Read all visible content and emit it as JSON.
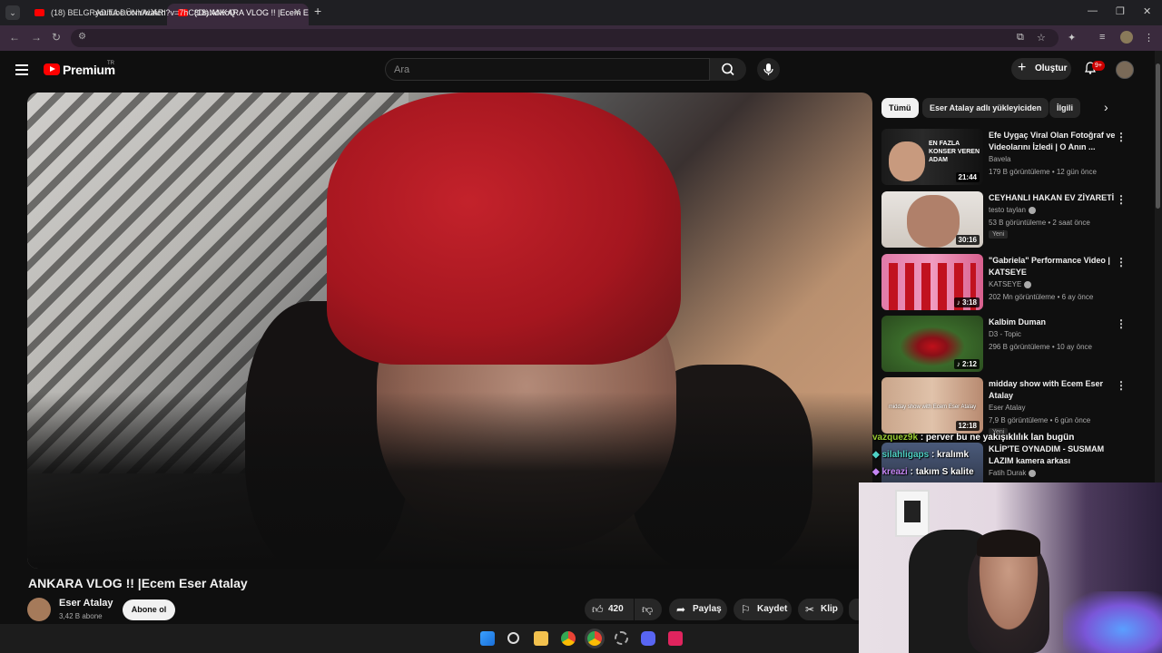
{
  "browser": {
    "tabs": [
      {
        "title": "(18) BELGRAD'TA DÜNYALARI Y",
        "active": false
      },
      {
        "title": "(18) ANKARA VLOG !! |Ecem Ese",
        "active": true
      }
    ],
    "url": "youtube.com/watch?v=7hC8DaNdKcQ"
  },
  "youtube": {
    "logo": "Premium",
    "region": "TR",
    "search_placeholder": "Ara",
    "create_label": "Oluştur",
    "notif_badge": "9+"
  },
  "video": {
    "title": "ANKARA VLOG !! |Ecem Eser Atalay",
    "channel": "Eser Atalay",
    "subscribers": "3,42 B abone",
    "subscribe_label": "Abone ol",
    "likes": "420",
    "share_label": "Paylaş",
    "save_label": "Kaydet",
    "clip_label": "Klip"
  },
  "chips": [
    "Tümü",
    "Eser Atalay adlı yükleyiciden",
    "İlgili"
  ],
  "recommendations": [
    {
      "title": "Efe Uygaç Viral Olan Fotoğraf ve Videolarını İzledi | O Anın ...",
      "channel": "Bavela",
      "meta": "179 B görüntüleme • 12 gün önce",
      "duration": "21:44",
      "badge": "",
      "thumb_text": "EN FAZLA KONSER VEREN ADAM"
    },
    {
      "title": "CEYHANLI HAKAN EV ZİYARETİ",
      "channel": "testo taylan",
      "meta": "53 B görüntüleme • 2 saat önce",
      "duration": "30:16",
      "badge": "Yeni",
      "thumb_text": ""
    },
    {
      "title": "\"Gabriela\" Performance Video | KATSEYE",
      "channel": "KATSEYE",
      "meta": "202 Mn görüntüleme • 6 ay önce",
      "duration": "3:18",
      "badge": "",
      "thumb_text": ""
    },
    {
      "title": "Kalbim Duman",
      "channel": "D3 - Topic",
      "meta": "296 B görüntüleme • 10 ay önce",
      "duration": "2:12",
      "badge": "",
      "thumb_text": ""
    },
    {
      "title": "midday show with Ecem Eser Atalay",
      "channel": "Eser Atalay",
      "meta": "7,9 B görüntüleme • 6 gün önce",
      "duration": "12:18",
      "badge": "Yeni",
      "thumb_text": "midday show with Ecem Eser Atalay"
    },
    {
      "title": "KLİP'TE OYNADIM - SUSMAM LAZIM kamera arkası",
      "channel": "Fatih Durak",
      "meta": "",
      "duration": "",
      "badge": "",
      "thumb_text": ""
    }
  ],
  "chat": [
    {
      "user": "vazquez9k",
      "message": ": perver bu ne yakışıklılık lan bugün"
    },
    {
      "user": "silahligaps",
      "message": ": kralımk"
    },
    {
      "user": "kreazi",
      "message": ": takım S kalite"
    }
  ],
  "colors": {
    "accent": "#ff0000",
    "bg": "#0f0f0f",
    "tab_active": "#3a2a3d"
  }
}
